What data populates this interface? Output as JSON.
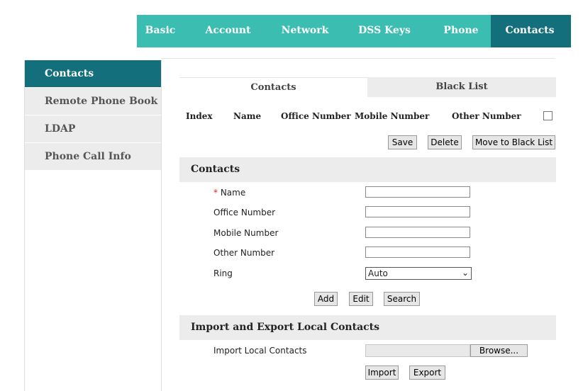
{
  "topnav": {
    "tabs": [
      {
        "label": "Basic"
      },
      {
        "label": "Account"
      },
      {
        "label": "Network"
      },
      {
        "label": "DSS Keys"
      },
      {
        "label": "Phone"
      },
      {
        "label": "Contacts"
      }
    ],
    "active": "Contacts"
  },
  "sidebar": {
    "items": [
      {
        "label": "Contacts"
      },
      {
        "label": "Remote Phone Book"
      },
      {
        "label": "LDAP"
      },
      {
        "label": "Phone Call Info"
      }
    ],
    "active": "Contacts"
  },
  "subtabs": [
    {
      "label": "Contacts"
    },
    {
      "label": "Black List"
    }
  ],
  "table": {
    "headers": [
      "Index",
      "Name",
      "Office Number",
      "Mobile Number",
      "Other Number"
    ]
  },
  "actions": {
    "save": "Save",
    "delete": "Delete",
    "move_to_black_list": "Move to Black List"
  },
  "contacts_form": {
    "title": "Contacts",
    "required_mark": "*",
    "name_label": "Name",
    "office_label": "Office Number",
    "mobile_label": "Mobile Number",
    "other_label": "Other Number",
    "ring_label": "Ring",
    "ring_value": "Auto",
    "add": "Add",
    "edit": "Edit",
    "search": "Search"
  },
  "import_export": {
    "title": "Import and Export Local Contacts",
    "import_label": "Import Local Contacts",
    "browse": "Browse...",
    "import": "Import",
    "export": "Export"
  },
  "colors": {
    "teal": "#3bbdb1",
    "dark_teal": "#136f7b",
    "panel_gray": "#ececec"
  }
}
